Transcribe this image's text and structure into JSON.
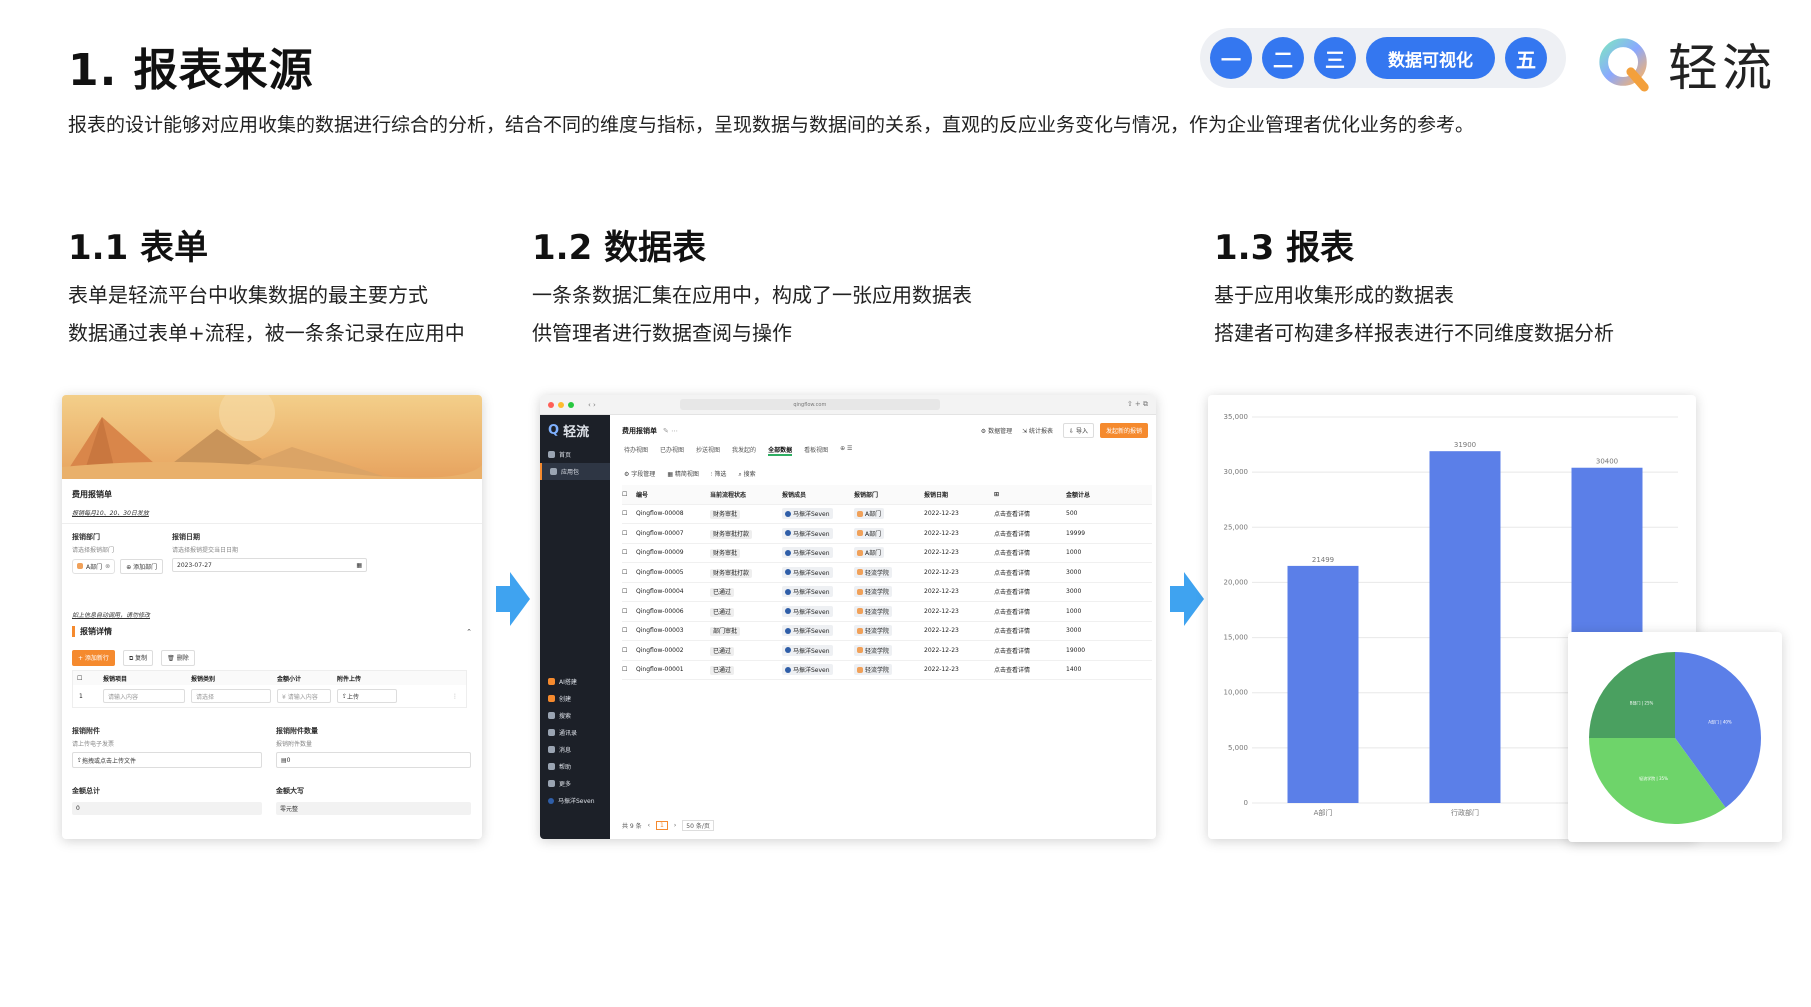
{
  "header": {
    "title": "1. 报表来源",
    "description": "报表的设计能够对应用收集的数据进行综合的分析，结合不同的维度与指标，呈现数据与数据间的关系，直观的反应业务变化与情况，作为企业管理者优化业务的参考。",
    "nav": [
      "一",
      "二",
      "三",
      "数据可视化",
      "五"
    ],
    "logo_text": "轻流"
  },
  "sections": [
    {
      "title": "1.1 表单",
      "lines": [
        "表单是轻流平台中收集数据的最主要方式",
        "数据通过表单+流程，被一条条记录在应用中"
      ]
    },
    {
      "title": "1.2 数据表",
      "lines": [
        "一条条数据汇集在应用中，构成了一张应用数据表",
        "供管理者进行数据查阅与操作"
      ]
    },
    {
      "title": "1.3 报表",
      "lines": [
        "基于应用收集形成的数据表",
        "搭建者可构建多样报表进行不同维度数据分析"
      ]
    }
  ],
  "form": {
    "title": "费用报销单",
    "subtitle": "报销每月10、20、30日发放",
    "dept_label": "报销部门",
    "dept_hint": "请选择报销部门",
    "dept_value": "A部门",
    "add_dept": "添加部门",
    "date_label": "报销日期",
    "date_hint": "请选择报销提交当日日期",
    "date_value": "2023-07-27",
    "note": "如上信息自动调用，请勿修改",
    "detail_title": "报销详情",
    "buttons": [
      "+ 添加新行",
      "复制",
      "删除"
    ],
    "columns": [
      "报销项目",
      "报销类别",
      "金额小计",
      "附件上传"
    ],
    "row_index": "1",
    "row_cells": [
      "请输入内容",
      "请选择",
      "¥ 请输入内容",
      "上传"
    ],
    "attach_label": "报销附件",
    "attach_hint": "请上传电子发票",
    "attach_btn": "拖拽或点击上传文件",
    "attach_count_label": "报销附件数量",
    "attach_count_hint": "报销附件数量",
    "attach_count_value": "0",
    "total_label": "金额总计",
    "total_value": "0",
    "upper_label": "金额大写",
    "upper_value": "零元整"
  },
  "datatable": {
    "url": "qingflow.com",
    "app_title": "费用报销单",
    "top_actions": [
      "数据管理",
      "统计报表",
      "导入",
      "发起新的报销"
    ],
    "views": [
      "待办视图",
      "已办视图",
      "抄送视图",
      "我发起的",
      "全部数据",
      "看板视图"
    ],
    "tools": [
      "字段管理",
      "精简视图",
      "筛选",
      "搜索"
    ],
    "sidebar_brand": "轻流",
    "sidebar_top": [
      "首页",
      "应用包"
    ],
    "sidebar_bottom": [
      "AI搭建",
      "创建",
      "搜索",
      "通讯录",
      "消息",
      "帮助",
      "更多",
      "马振洋Seven"
    ],
    "columns": [
      "编号",
      "当前流程状态",
      "报销成员",
      "报销部门",
      "报销日期",
      "",
      "金额计总"
    ],
    "rows": [
      {
        "id": "Qingflow-00008",
        "status": "财务审批",
        "member": "马振洋Seven",
        "dept": "A部门",
        "date": "2022-12-23",
        "link": "点击查看详情",
        "amount": "500"
      },
      {
        "id": "Qingflow-00007",
        "status": "财务审批打款",
        "member": "马振洋Seven",
        "dept": "A部门",
        "date": "2022-12-23",
        "link": "点击查看详情",
        "amount": "19999"
      },
      {
        "id": "Qingflow-00009",
        "status": "财务审批",
        "member": "马振洋Seven",
        "dept": "A部门",
        "date": "2022-12-23",
        "link": "点击查看详情",
        "amount": "1000"
      },
      {
        "id": "Qingflow-00005",
        "status": "财务审批打款",
        "member": "马振洋Seven",
        "dept": "轻流学院",
        "date": "2022-12-23",
        "link": "点击查看详情",
        "amount": "3000"
      },
      {
        "id": "Qingflow-00004",
        "status": "已通过",
        "member": "马振洋Seven",
        "dept": "轻流学院",
        "date": "2022-12-23",
        "link": "点击查看详情",
        "amount": "3000"
      },
      {
        "id": "Qingflow-00006",
        "status": "已通过",
        "member": "马振洋Seven",
        "dept": "轻流学院",
        "date": "2022-12-23",
        "link": "点击查看详情",
        "amount": "1000"
      },
      {
        "id": "Qingflow-00003",
        "status": "部门审批",
        "member": "马振洋Seven",
        "dept": "轻流学院",
        "date": "2022-12-23",
        "link": "点击查看详情",
        "amount": "3000"
      },
      {
        "id": "Qingflow-00002",
        "status": "已通过",
        "member": "马振洋Seven",
        "dept": "轻流学院",
        "date": "2022-12-23",
        "link": "点击查看详情",
        "amount": "19000"
      },
      {
        "id": "Qingflow-00001",
        "status": "已通过",
        "member": "马振洋Seven",
        "dept": "轻流学院",
        "date": "2022-12-23",
        "link": "点击查看详情",
        "amount": "1400"
      }
    ],
    "footer_total": "共 9 条",
    "footer_page": "1",
    "footer_size": "50 条/页"
  },
  "chart_data": {
    "type": "bar",
    "categories": [
      "A部门",
      "行政部门",
      ""
    ],
    "values": [
      21499,
      31900,
      30400
    ],
    "data_labels": [
      "21499",
      "31900",
      "30400"
    ],
    "ylim": [
      0,
      35000
    ],
    "y_ticks": [
      "0",
      "5,000",
      "10,000",
      "15,000",
      "20,000",
      "25,000",
      "30,000",
      "35,000"
    ],
    "bar_color": "#5b7fe8",
    "grid": true,
    "inset_pie": {
      "type": "pie",
      "slices": [
        {
          "label": "A部门 | 40%",
          "value": 40,
          "color": "#5b7fe8"
        },
        {
          "label": "轻流学院 | 35%",
          "value": 35,
          "color": "#6ed46a"
        },
        {
          "label": "B部门 | 25%",
          "value": 25,
          "color": "#4aa060"
        }
      ]
    }
  },
  "colors": {
    "accent": "#3477f0",
    "arrow": "#3fa3f0",
    "orange": "#f58a2e"
  }
}
